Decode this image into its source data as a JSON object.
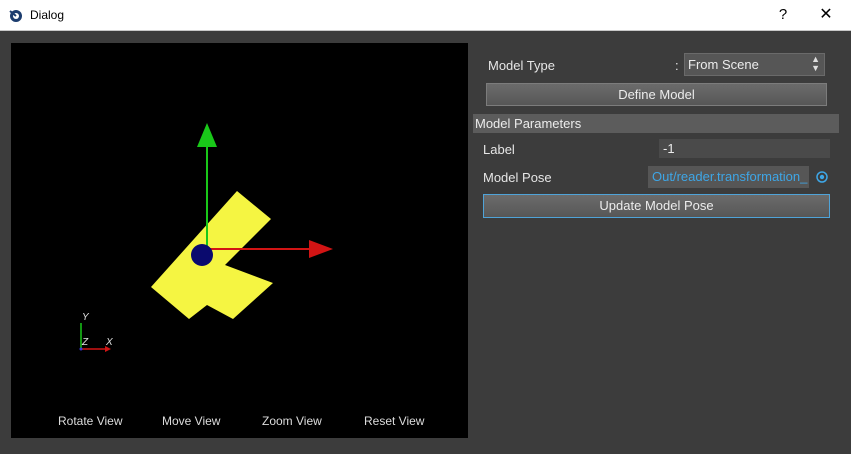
{
  "window": {
    "title": "Dialog",
    "help_label": "?",
    "close_label": "✕"
  },
  "viewport": {
    "axis_labels": {
      "y": "Y",
      "z": "Z",
      "x": "X"
    },
    "view_buttons": {
      "rotate": "Rotate View",
      "move": "Move View",
      "zoom": "Zoom View",
      "reset": "Reset View"
    }
  },
  "panel": {
    "model_type_label": "Model Type",
    "model_type_colon": ":",
    "model_type_value": "From Scene",
    "define_model_label": "Define Model",
    "parameters_header": "Model Parameters",
    "label_label": "Label",
    "label_value": "-1",
    "model_pose_label": "Model Pose",
    "model_pose_value": "Out/reader.transformation_",
    "update_pose_label": "Update Model Pose"
  },
  "colors": {
    "object": "#f5f542",
    "y_axis": "#19c819",
    "x_axis": "#d21414",
    "origin": "#0a0a6e",
    "link": "#3ea6e6"
  }
}
